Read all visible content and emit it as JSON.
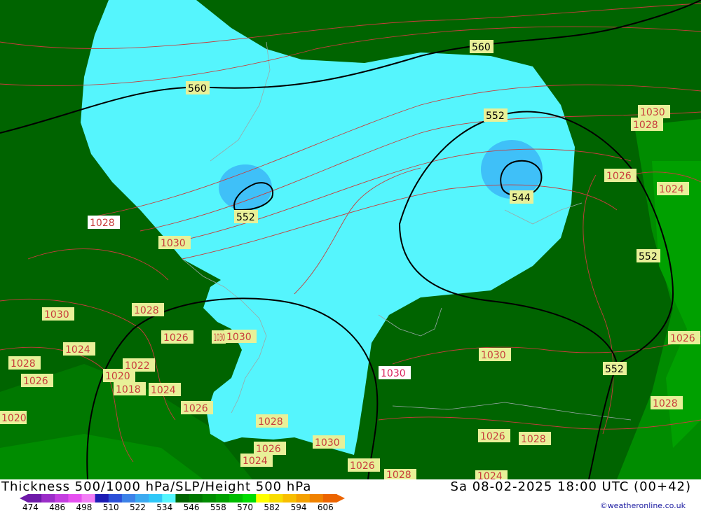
{
  "title": "Thickness 500/1000 hPa/SLP/Height 500 hPa",
  "timestamp": "Sa 08-02-2025 18:00 UTC (00+42)",
  "credit": "©weatheronline.co.uk",
  "colors": {
    "dark_green": "#006400",
    "mid_green": "#007c00",
    "bright_green": "#00a000",
    "cyan": "#55f5fd",
    "light_blue": "#3fc0f8",
    "isobar": "#c83c3c",
    "height_contour": "#000000",
    "label_bg": "#e8f098"
  },
  "colorbar": {
    "colors": [
      "#6e1aa8",
      "#9b2dc8",
      "#c43ee0",
      "#e650f0",
      "#f27ef5",
      "#1c1cb4",
      "#2c50d8",
      "#3c82e8",
      "#3caaf0",
      "#30c8f8",
      "#55f5fd",
      "#006400",
      "#007800",
      "#008c00",
      "#00a000",
      "#00bc00",
      "#00dc00",
      "#ffff00",
      "#f8dc00",
      "#f8be00",
      "#f4a000",
      "#f08200",
      "#ec6400"
    ],
    "labels": [
      "474",
      "486",
      "498",
      "510",
      "522",
      "534",
      "546",
      "558",
      "570",
      "582",
      "594",
      "606"
    ]
  },
  "height_labels": [
    "560",
    "560",
    "552",
    "552",
    "544",
    "552",
    "552"
  ],
  "pressure_labels": [
    "1030",
    "1028",
    "1026",
    "1024",
    "1028",
    "1030",
    "1030",
    "1028",
    "1030",
    "1024",
    "1028",
    "1026",
    "1020",
    "1022",
    "1018",
    "1024",
    "1026",
    "1026",
    "1030",
    "1030",
    "1028",
    "1026",
    "1024",
    "1030",
    "1026",
    "1030",
    "1026",
    "1028",
    "1026",
    "1028",
    "1020",
    "1028",
    "1024"
  ]
}
